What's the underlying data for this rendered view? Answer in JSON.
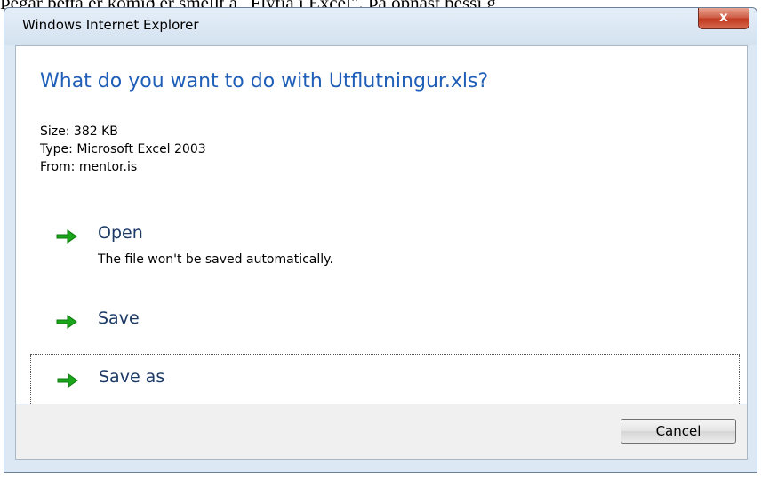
{
  "background_text": "Þegar þetta er komið er smellt á „Flytja í Excel\". Þá opnast þessi g",
  "window": {
    "title": "Windows Internet Explorer",
    "close_label": "x"
  },
  "dialog": {
    "heading": "What do you want to do with Utflutningur.xls?",
    "size": "Size: 382 KB",
    "type": "Type: Microsoft Excel 2003",
    "from": "From: mentor.is",
    "options": [
      {
        "label": "Open",
        "subtext": "The file won't be saved automatically.",
        "icon": "green-arrow-icon"
      },
      {
        "label": "Save",
        "icon": "green-arrow-icon"
      },
      {
        "label": "Save as",
        "icon": "green-arrow-icon"
      }
    ],
    "cancel_label": "Cancel"
  },
  "colors": {
    "heading": "#1f5fb8",
    "arrow": "#1aa51a",
    "close_button": "#c0391f"
  }
}
